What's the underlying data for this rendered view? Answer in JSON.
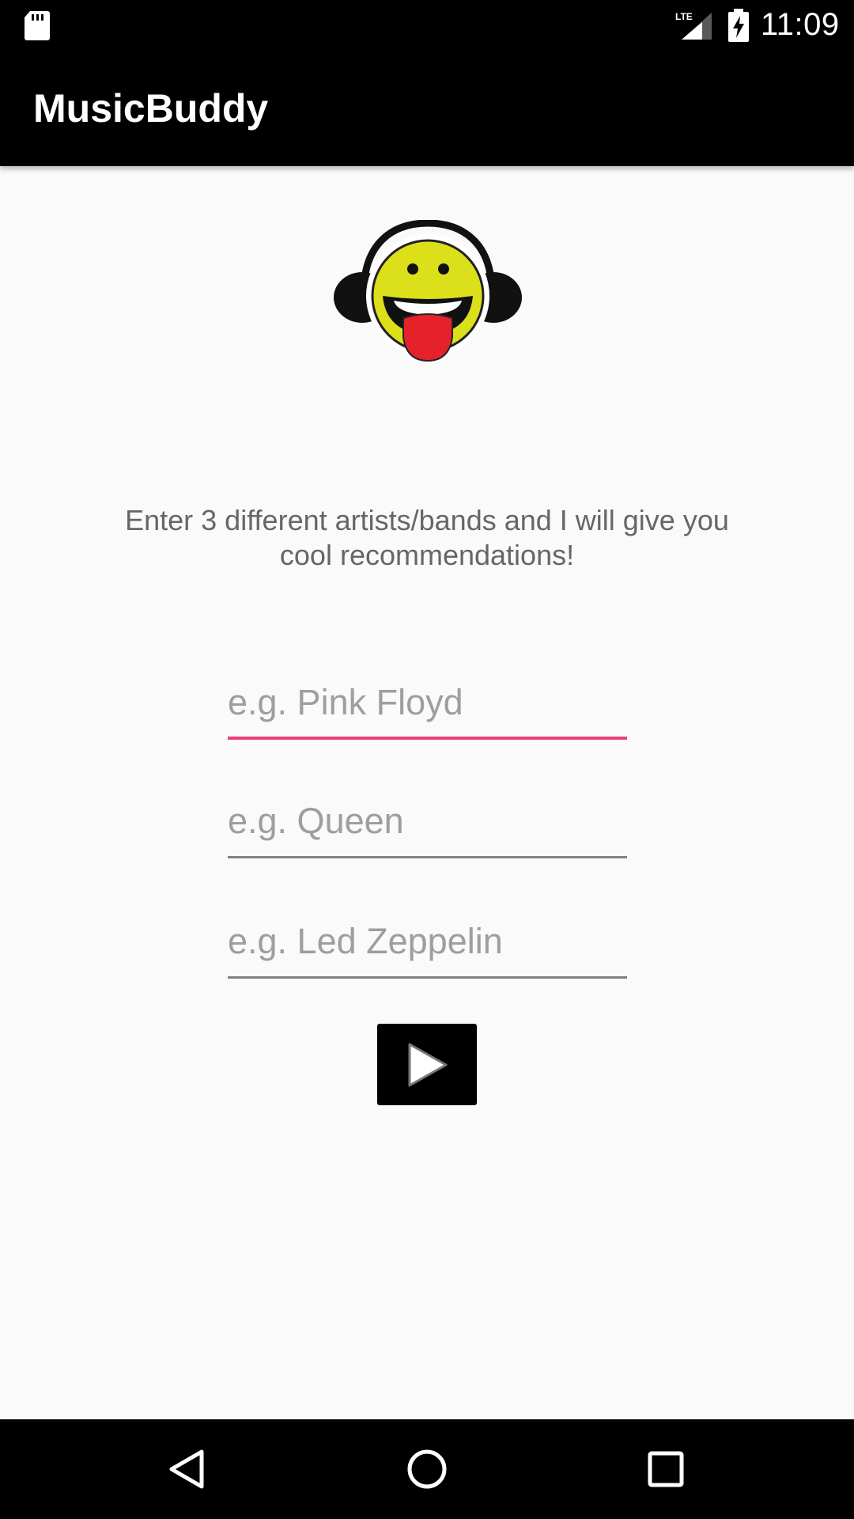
{
  "status_bar": {
    "time": "11:09",
    "network_label": "LTE",
    "icons": [
      "sd-card-icon",
      "signal-lte-icon",
      "battery-charging-icon"
    ]
  },
  "app_bar": {
    "title": "MusicBuddy"
  },
  "main": {
    "logo_icon": "smiley-headphones-icon",
    "prompt": "Enter 3 different artists/bands and I will give you cool recommendations!",
    "fields": [
      {
        "placeholder": "e.g. Pink Floyd",
        "value": ""
      },
      {
        "placeholder": "e.g. Queen",
        "value": ""
      },
      {
        "placeholder": "e.g. Led Zeppelin",
        "value": ""
      }
    ],
    "submit_icon": "play-icon"
  },
  "nav_bar": {
    "icons": [
      "back-icon",
      "home-icon",
      "recents-icon"
    ]
  },
  "colors": {
    "accent": "#ec407a",
    "bar_background": "#000000",
    "page_background": "#fafafa"
  }
}
